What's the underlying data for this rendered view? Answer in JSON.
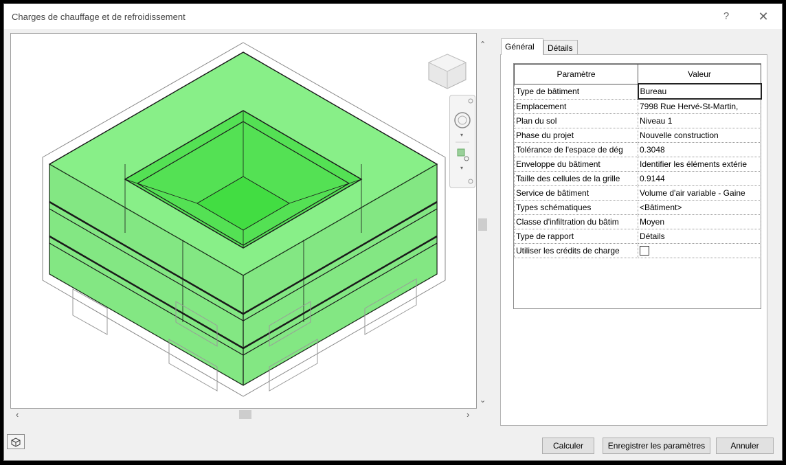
{
  "window": {
    "title": "Charges de chauffage et de refroidissement",
    "help": "?",
    "close": "✕"
  },
  "tabs": [
    {
      "label": "Général"
    },
    {
      "label": "Détails"
    }
  ],
  "grid": {
    "headers": {
      "param": "Paramètre",
      "value": "Valeur"
    },
    "rows": [
      {
        "param": "Type de bâtiment",
        "value": "Bureau"
      },
      {
        "param": "Emplacement",
        "value": "7998 Rue Hervé-St-Martin,"
      },
      {
        "param": "Plan du sol",
        "value": "Niveau 1"
      },
      {
        "param": "Phase du projet",
        "value": "Nouvelle construction"
      },
      {
        "param": "Tolérance de l'espace de dég",
        "value": "0.3048"
      },
      {
        "param": "Enveloppe du bâtiment",
        "value": "Identifier les éléments extérie"
      },
      {
        "param": "Taille des cellules de la grille",
        "value": "0.9144"
      },
      {
        "param": "Service de bâtiment",
        "value": "Volume d'air variable - Gaine"
      },
      {
        "param": "Types schématiques",
        "value": "<Bâtiment>"
      },
      {
        "param": "Classe d'infiltration du bâtim",
        "value": "Moyen"
      },
      {
        "param": "Type de rapport",
        "value": "Détails"
      },
      {
        "param": "Utiliser les crédits de charge",
        "value": ""
      }
    ]
  },
  "buttons": {
    "calc": "Calculer",
    "save": "Enregistrer les paramètres",
    "cancel": "Annuler"
  },
  "icons": {
    "viewcube": "viewcube-icon",
    "orbit": "steering-wheel-icon",
    "zoom": "zoom-region-icon",
    "view3d": "3d-view-icon"
  },
  "colors": {
    "model_fill": "#33dd33",
    "model_edge": "#1a1a1a"
  }
}
